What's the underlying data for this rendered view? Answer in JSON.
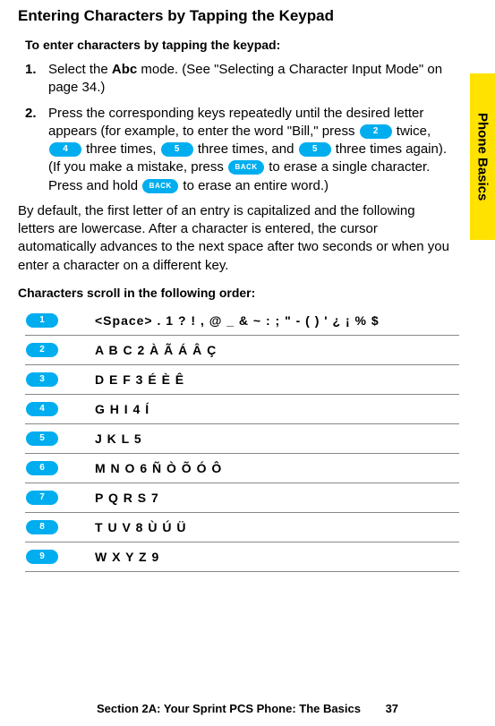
{
  "heading": "Entering Characters by Tapping the Keypad",
  "intro": "To enter characters by tapping the keypad:",
  "steps": [
    {
      "num": "1.",
      "pre": "Select the ",
      "bold": "Abc",
      "post": " mode. (See \"Selecting a Character Input Mode\" on page 34.)"
    }
  ],
  "step2": {
    "num": "2.",
    "t1": "Press the corresponding keys repeatedly until the desired letter appears (for example, to enter the word \"Bill,\" press ",
    "k1": "2",
    "t2": " twice, ",
    "k2": "4",
    "t3": " three times, ",
    "k3": "5",
    "t4": " three times, and ",
    "k4": "5",
    "t5": " three times again).",
    "t6": "(If you make a mistake, press ",
    "k5": "BACK",
    "t7": " to erase a single character. Press and hold ",
    "k6": "BACK",
    "t8": " to erase an entire word.)"
  },
  "para": "By default, the first letter of an entry is capitalized and the following letters are lowercase. After a character is entered, the cursor automatically advances to the next space after two seconds or when you enter a character on a different key.",
  "scrollTitle": "Characters scroll in the following order:",
  "rows": [
    {
      "key": "1",
      "chars": "<Space> . 1 ? ! , @ _ & ~ : ; \" - ( ) ' ¿ ¡ % $"
    },
    {
      "key": "2",
      "chars": "A B C 2 À Ã Á Â Ç"
    },
    {
      "key": "3",
      "chars": "D E F 3 É È Ê"
    },
    {
      "key": "4",
      "chars": "G H I 4 Í"
    },
    {
      "key": "5",
      "chars": "J K L 5"
    },
    {
      "key": "6",
      "chars": "M N O 6 Ñ Ò Õ Ó Ô"
    },
    {
      "key": "7",
      "chars": "P Q R S 7"
    },
    {
      "key": "8",
      "chars": "T U V 8 Ù Ú Ü"
    },
    {
      "key": "9",
      "chars": "W X Y Z 9"
    }
  ],
  "sideTab": "Phone Basics",
  "footer": {
    "text": "Section 2A: Your Sprint PCS Phone: The Basics",
    "page": "37"
  }
}
